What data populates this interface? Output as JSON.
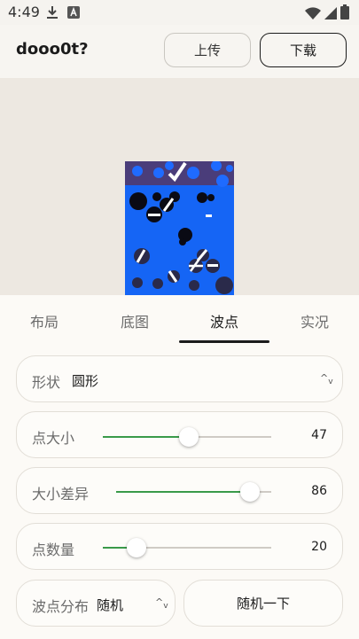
{
  "status": {
    "time": "4:49"
  },
  "app": {
    "title": "dooo0t?",
    "upload_label": "上传",
    "download_label": "下载"
  },
  "tabs": [
    {
      "label": "布局",
      "active": false
    },
    {
      "label": "底图",
      "active": false
    },
    {
      "label": "波点",
      "active": true
    },
    {
      "label": "实况",
      "active": false
    }
  ],
  "controls": {
    "shape": {
      "label": "形状",
      "value": "圆形"
    },
    "dot_size": {
      "label": "点大小",
      "value": "47",
      "fraction": 0.51
    },
    "size_variance": {
      "label": "大小差异",
      "value": "86",
      "fraction": 0.86
    },
    "dot_count": {
      "label": "点数量",
      "value": "20",
      "fraction": 0.2
    },
    "distribution": {
      "label": "波点分布",
      "value": "随机"
    },
    "randomize_label": "随机一下"
  },
  "colors": {
    "accent": "#3a9a4a",
    "preview_blue": "#1565f5",
    "preview_top": "#4a3d7a"
  }
}
